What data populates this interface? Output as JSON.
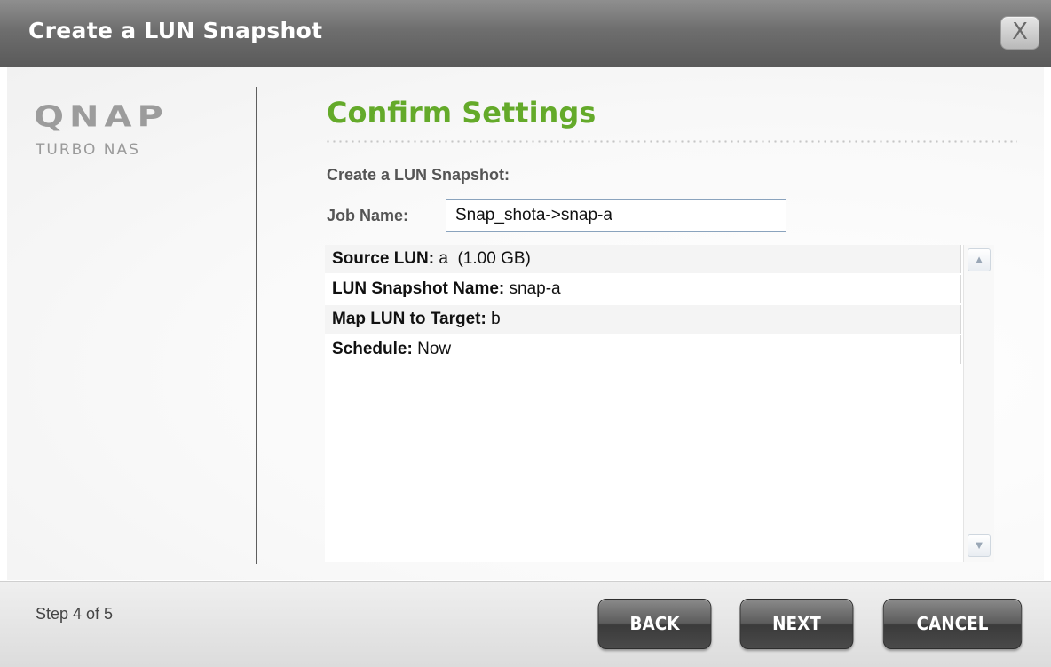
{
  "window": {
    "title": "Create a LUN Snapshot",
    "close_icon": "close-icon",
    "close_label": "X"
  },
  "logo": {
    "brand": "QNAP",
    "product": "TURBO NAS"
  },
  "main": {
    "heading": "Confirm Settings",
    "subheading": "Create a LUN Snapshot:",
    "job_name_label": "Job Name:",
    "job_name_value": "Snap_shota->snap-a",
    "summary": [
      {
        "key": "Source LUN:",
        "value": " a  (1.00 GB)"
      },
      {
        "key": "LUN Snapshot Name:",
        "value": " snap-a"
      },
      {
        "key": "Map LUN to Target:",
        "value": " b"
      },
      {
        "key": "Schedule:",
        "value": " Now"
      }
    ],
    "scroll_up_icon": "chevron-up-icon",
    "scroll_down_icon": "chevron-down-icon"
  },
  "footer": {
    "step_text": "Step 4 of 5",
    "back_label": "BACK",
    "next_label": "NEXT",
    "cancel_label": "CANCEL"
  },
  "colors": {
    "heading_green": "#64aa2a",
    "titlebar": "#6e6e6e",
    "button_dark": "#4a4a4a"
  }
}
